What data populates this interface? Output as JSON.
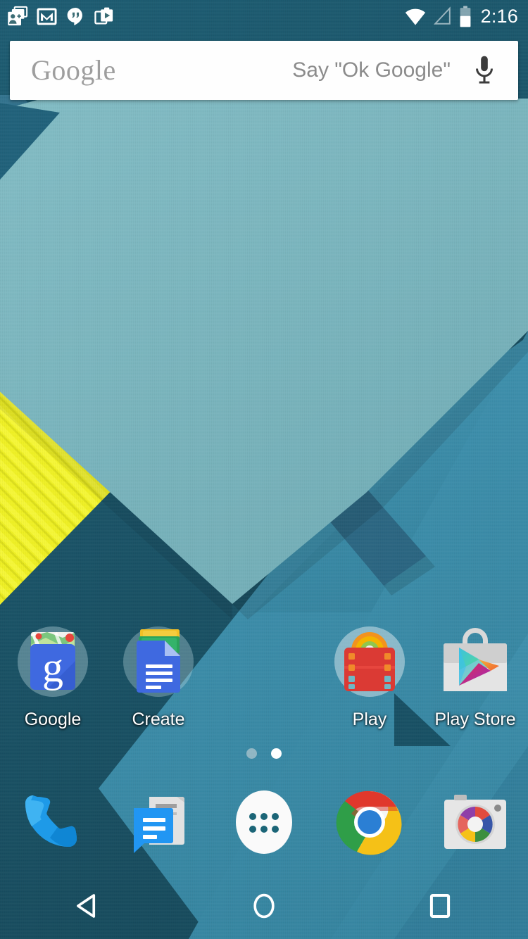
{
  "device": {
    "os": "Android 5.0 Lollipop",
    "screen": "home-screen"
  },
  "status_bar": {
    "time": "2:16",
    "left_icons": [
      {
        "name": "google-plus-notification-icon",
        "label": "Google+"
      },
      {
        "name": "gmail-notification-icon",
        "label": "Gmail"
      },
      {
        "name": "hangouts-notification-icon",
        "label": "Hangouts"
      },
      {
        "name": "play-store-notification-icon",
        "label": "Play Store"
      }
    ],
    "right_icons": [
      {
        "name": "wifi-icon",
        "label": "Wi-Fi",
        "state": "full"
      },
      {
        "name": "cellular-signal-icon",
        "label": "Mobile signal",
        "state": "no-service"
      },
      {
        "name": "battery-icon",
        "label": "Battery",
        "level_percent": 50
      }
    ]
  },
  "search_bar": {
    "logo_text": "Google",
    "hint_text": "Say \"Ok Google\"",
    "mic_icon": "microphone-icon"
  },
  "home": {
    "apps": [
      {
        "id": "google",
        "label": "Google",
        "type": "folder",
        "icon": "google-folder-icon"
      },
      {
        "id": "create",
        "label": "Create",
        "type": "folder",
        "icon": "create-folder-icon"
      },
      {
        "id": "spacer1",
        "label": "",
        "type": "empty",
        "icon": ""
      },
      {
        "id": "play",
        "label": "Play",
        "type": "folder",
        "icon": "play-folder-icon"
      },
      {
        "id": "play-store",
        "label": "Play Store",
        "type": "app",
        "icon": "play-store-icon"
      }
    ],
    "page_indicator": {
      "total": 2,
      "current": 2
    }
  },
  "dock": {
    "items": [
      {
        "id": "phone",
        "label": "Phone",
        "icon": "phone-icon"
      },
      {
        "id": "messenger",
        "label": "Messenger",
        "icon": "messenger-icon"
      },
      {
        "id": "app-drawer",
        "label": "Apps",
        "icon": "app-drawer-icon"
      },
      {
        "id": "chrome",
        "label": "Chrome",
        "icon": "chrome-icon"
      },
      {
        "id": "camera",
        "label": "Camera",
        "icon": "camera-icon"
      }
    ]
  },
  "nav_bar": {
    "buttons": [
      {
        "id": "back",
        "label": "Back",
        "icon": "back-triangle-icon"
      },
      {
        "id": "home",
        "label": "Home",
        "icon": "home-circle-icon"
      },
      {
        "id": "recents",
        "label": "Recents",
        "icon": "recents-square-icon"
      }
    ]
  },
  "colors": {
    "wallpaper_light_teal": "#7ab5bd",
    "wallpaper_mid_blue": "#3c8fae",
    "wallpaper_dark_band": "#2e6d8a",
    "wallpaper_deep_teal": "#1a5468",
    "wallpaper_yellow": "#eff024",
    "search_bar_bg": "#fefefe",
    "google_logo_gray": "#9e9e9e",
    "hint_gray": "#8b8b8b",
    "status_text": "#ffffff",
    "label_text": "#ffffff"
  }
}
